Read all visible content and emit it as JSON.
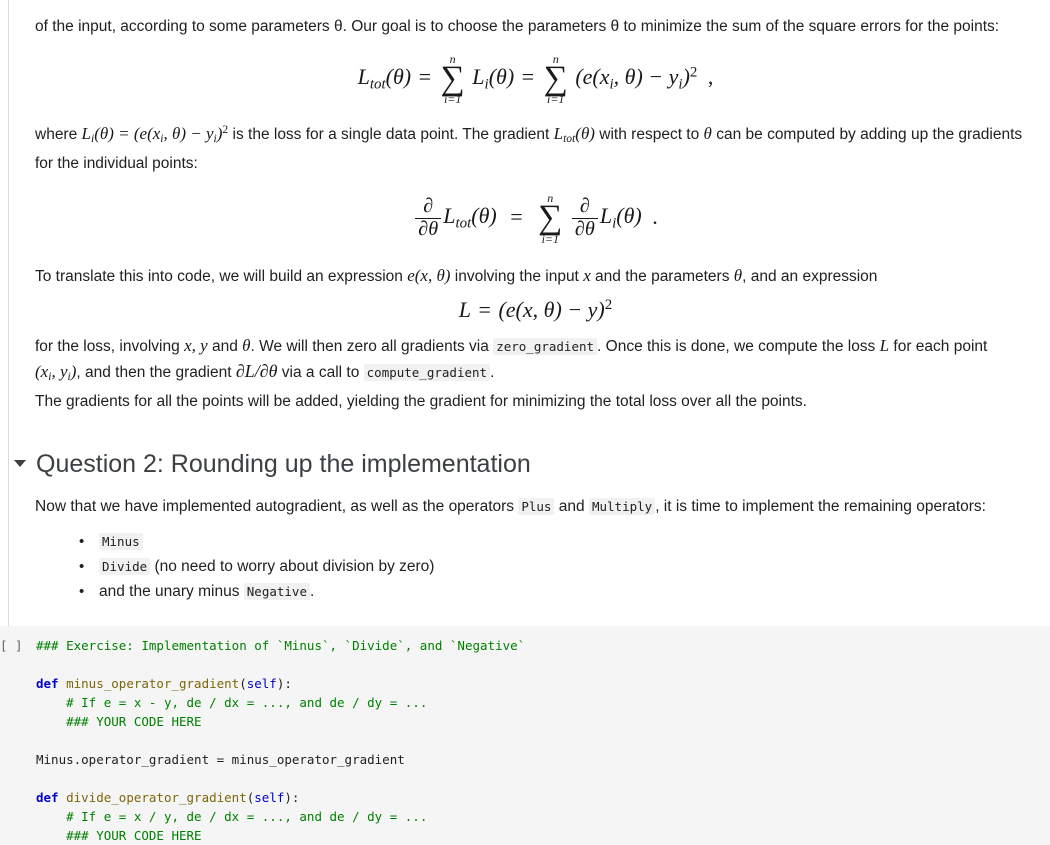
{
  "document": {
    "type": "jupyter-notebook",
    "code_cell_bg": "#f5f5f5",
    "accent": "#3c4043"
  },
  "intro": {
    "line1": "of the input, according to some parameters θ. Our goal is to choose the parameters θ to minimize the sum of the square errors for the points:"
  },
  "equations": {
    "eq1": {
      "lhs": "L",
      "lhs_sub": "tot",
      "lhs_arg": "(θ)",
      "eq": "=",
      "sum_top": "n",
      "sum_bot": "i=1",
      "term1": "L",
      "term1_sub": "i",
      "term1_arg": "(θ)",
      "eq2": "=",
      "term2": "(e(x",
      "term2_sub": "i",
      "term2_mid": ", θ) − y",
      "term2_sub2": "i",
      "term2_close": ")",
      "term2_pow": "2",
      "trailer": ","
    },
    "eq2": {
      "frac_num": "∂",
      "frac_den": "∂θ",
      "lhs": "L",
      "lhs_sub": "tot",
      "lhs_arg": "(θ)",
      "eq": "=",
      "sum_top": "n",
      "sum_bot": "i=1",
      "rhs": "L",
      "rhs_sub": "i",
      "rhs_arg": "(θ)",
      "trailer": "."
    },
    "eq3": {
      "lhs": "L",
      "eq": "=",
      "body": "(e(x, θ) − y)",
      "pow": "2"
    }
  },
  "paragraphs": {
    "where_p1": "where",
    "where_math_L": "L",
    "where_math_sub": "i",
    "where_math_rest": "(θ) = (e(x",
    "where_math_sub2": "i",
    "where_math_rest2": ", θ) − y",
    "where_math_sub3": "i",
    "where_math_close": ")",
    "where_math_pow": "2",
    "where_p2": "is the loss for a single data point. The gradient",
    "where_math2_L": "L",
    "where_math2_sub": "tot",
    "where_math2_arg": "(θ)",
    "where_p3": "with respect to",
    "where_math3": "θ",
    "where_p4": "can be computed by adding up the",
    "where_p5": "gradients for the individual points:",
    "translate_p1": "To translate this into code, we will build an expression",
    "translate_math1": "e(x, θ)",
    "translate_p2": "involving the input",
    "translate_math2": "x",
    "translate_p3": "and the parameters",
    "translate_math3": "θ",
    "translate_p4": ", and an expression",
    "loss_p1": "for the loss, involving",
    "loss_math1": "x, y",
    "loss_p2": "and",
    "loss_math2": "θ",
    "loss_p3": ". We will then zero all gradients via",
    "loss_code1": "zero_gradient",
    "loss_p4": ". Once this is done, we compute the loss",
    "loss_math3": "L",
    "loss_p5": "for each point",
    "loss_math4": "(x",
    "loss_math4_sub": "i",
    "loss_math4_mid": ", y",
    "loss_math4_sub2": "i",
    "loss_math4_close": ")",
    "loss_p6": ", and then the gradient",
    "loss_math5": "∂L/∂θ",
    "loss_p7": "via a call to",
    "loss_code2": "compute_gradient",
    "loss_p8": ".",
    "loss_p9": "The gradients for all the points will be added, yielding the gradient for minimizing the total loss over all the points."
  },
  "section": {
    "toggle_icon": "triangle-down-icon",
    "heading": "Question 2: Rounding up the implementation",
    "intro_p1": "Now that we have implemented autogradient, as well as the operators",
    "intro_code1": "Plus",
    "intro_p2": "and",
    "intro_code2": "Multiply",
    "intro_p3": ", it is time to implement the remaining operators:",
    "bullets": [
      {
        "code": "Minus",
        "text": ""
      },
      {
        "code": "Divide",
        "text": " (no need to worry about division by zero)"
      },
      {
        "pretext": "and the unary minus ",
        "code": "Negative",
        "text": "."
      }
    ]
  },
  "code_cell": {
    "prompt": "[ ]",
    "lines": [
      {
        "indent": 0,
        "tokens": [
          {
            "t": "comment",
            "v": "### Exercise: Implementation of `Minus`, `Divide`, and `Negative`"
          }
        ]
      },
      {
        "indent": 0,
        "tokens": [
          {
            "t": "plain",
            "v": ""
          }
        ]
      },
      {
        "indent": 0,
        "tokens": [
          {
            "t": "keyword",
            "v": "def"
          },
          {
            "t": "plain",
            "v": " "
          },
          {
            "t": "fn",
            "v": "minus_operator_gradient"
          },
          {
            "t": "plain",
            "v": "("
          },
          {
            "t": "self",
            "v": "self"
          },
          {
            "t": "plain",
            "v": "):"
          }
        ]
      },
      {
        "indent": 1,
        "tokens": [
          {
            "t": "comment",
            "v": "# If e = x - y, de / dx = ..., and de / dy = ..."
          }
        ]
      },
      {
        "indent": 1,
        "tokens": [
          {
            "t": "comment",
            "v": "### YOUR CODE HERE"
          }
        ]
      },
      {
        "indent": 0,
        "tokens": [
          {
            "t": "plain",
            "v": ""
          }
        ]
      },
      {
        "indent": 0,
        "tokens": [
          {
            "t": "plain",
            "v": "Minus.operator_gradient = minus_operator_gradient"
          }
        ]
      },
      {
        "indent": 0,
        "tokens": [
          {
            "t": "plain",
            "v": ""
          }
        ]
      },
      {
        "indent": 0,
        "tokens": [
          {
            "t": "keyword",
            "v": "def"
          },
          {
            "t": "plain",
            "v": " "
          },
          {
            "t": "fn",
            "v": "divide_operator_gradient"
          },
          {
            "t": "plain",
            "v": "("
          },
          {
            "t": "self",
            "v": "self"
          },
          {
            "t": "plain",
            "v": "):"
          }
        ]
      },
      {
        "indent": 1,
        "tokens": [
          {
            "t": "comment",
            "v": "# If e = x / y, de / dx = ..., and de / dy = ..."
          }
        ]
      },
      {
        "indent": 1,
        "tokens": [
          {
            "t": "comment",
            "v": "### YOUR CODE HERE"
          }
        ]
      }
    ]
  }
}
